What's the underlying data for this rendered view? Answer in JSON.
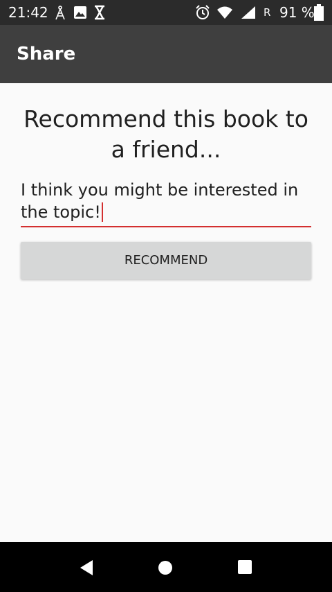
{
  "status_bar": {
    "time": "21:42",
    "network_letter": "R",
    "battery_percent": "91 %",
    "icons": [
      "signal-tower-icon",
      "image-notification-icon",
      "hourglass-icon",
      "alarm-icon",
      "wifi-icon",
      "cellular-signal-icon",
      "battery-icon"
    ],
    "battery_level": 0.91
  },
  "app_bar": {
    "title": "Share"
  },
  "main": {
    "heading": "Recommend this book to a friend...",
    "message_value": "I think you might be interested in the topic!",
    "button_label": "RECOMMEND"
  },
  "nav_bar": {
    "icons": [
      "back-icon",
      "home-icon",
      "recents-icon"
    ]
  },
  "colors": {
    "status_bar": "#2b2b2b",
    "app_bar": "#3f3f3f",
    "background": "#fafafa",
    "accent": "#d32f2f",
    "button": "#d6d7d7",
    "nav_bar": "#000000"
  }
}
